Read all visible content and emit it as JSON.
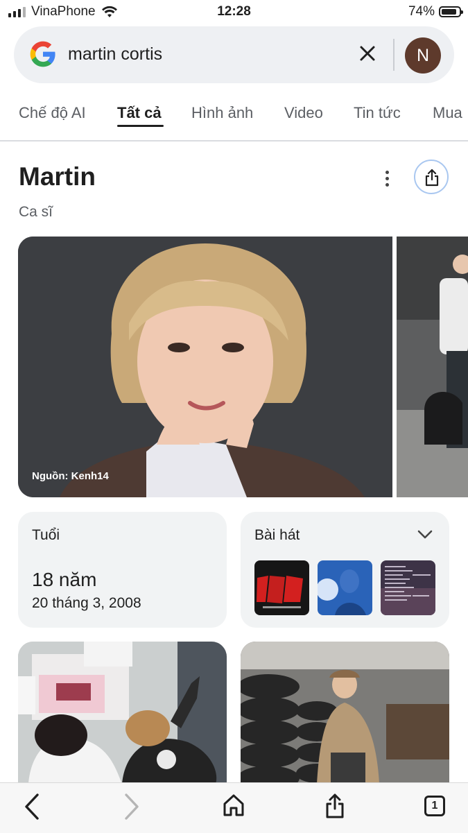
{
  "status_bar": {
    "carrier": "VinaPhone",
    "time": "12:28",
    "battery": "74%"
  },
  "search": {
    "query": "martin cortis"
  },
  "account": {
    "initial": "N"
  },
  "tabs": [
    {
      "label": "Chế độ AI"
    },
    {
      "label": "Tất cả"
    },
    {
      "label": "Hình ảnh"
    },
    {
      "label": "Video"
    },
    {
      "label": "Tin tức"
    },
    {
      "label": "Mua"
    }
  ],
  "active_tab": "Tất cả",
  "entity": {
    "title": "Martin",
    "subtitle": "Ca sĩ"
  },
  "hero_image": {
    "source": "Nguồn: Kenh14"
  },
  "cards": {
    "age": {
      "label": "Tuổi",
      "value": "18 năm",
      "birthdate": "20 tháng 3, 2008"
    },
    "songs": {
      "label": "Bài hát"
    }
  },
  "toolbar": {
    "tab_count": "1"
  },
  "colors": {
    "accent": "#1a73e8",
    "avatar": "#5e3a2c",
    "card_bg": "#f1f3f4"
  }
}
